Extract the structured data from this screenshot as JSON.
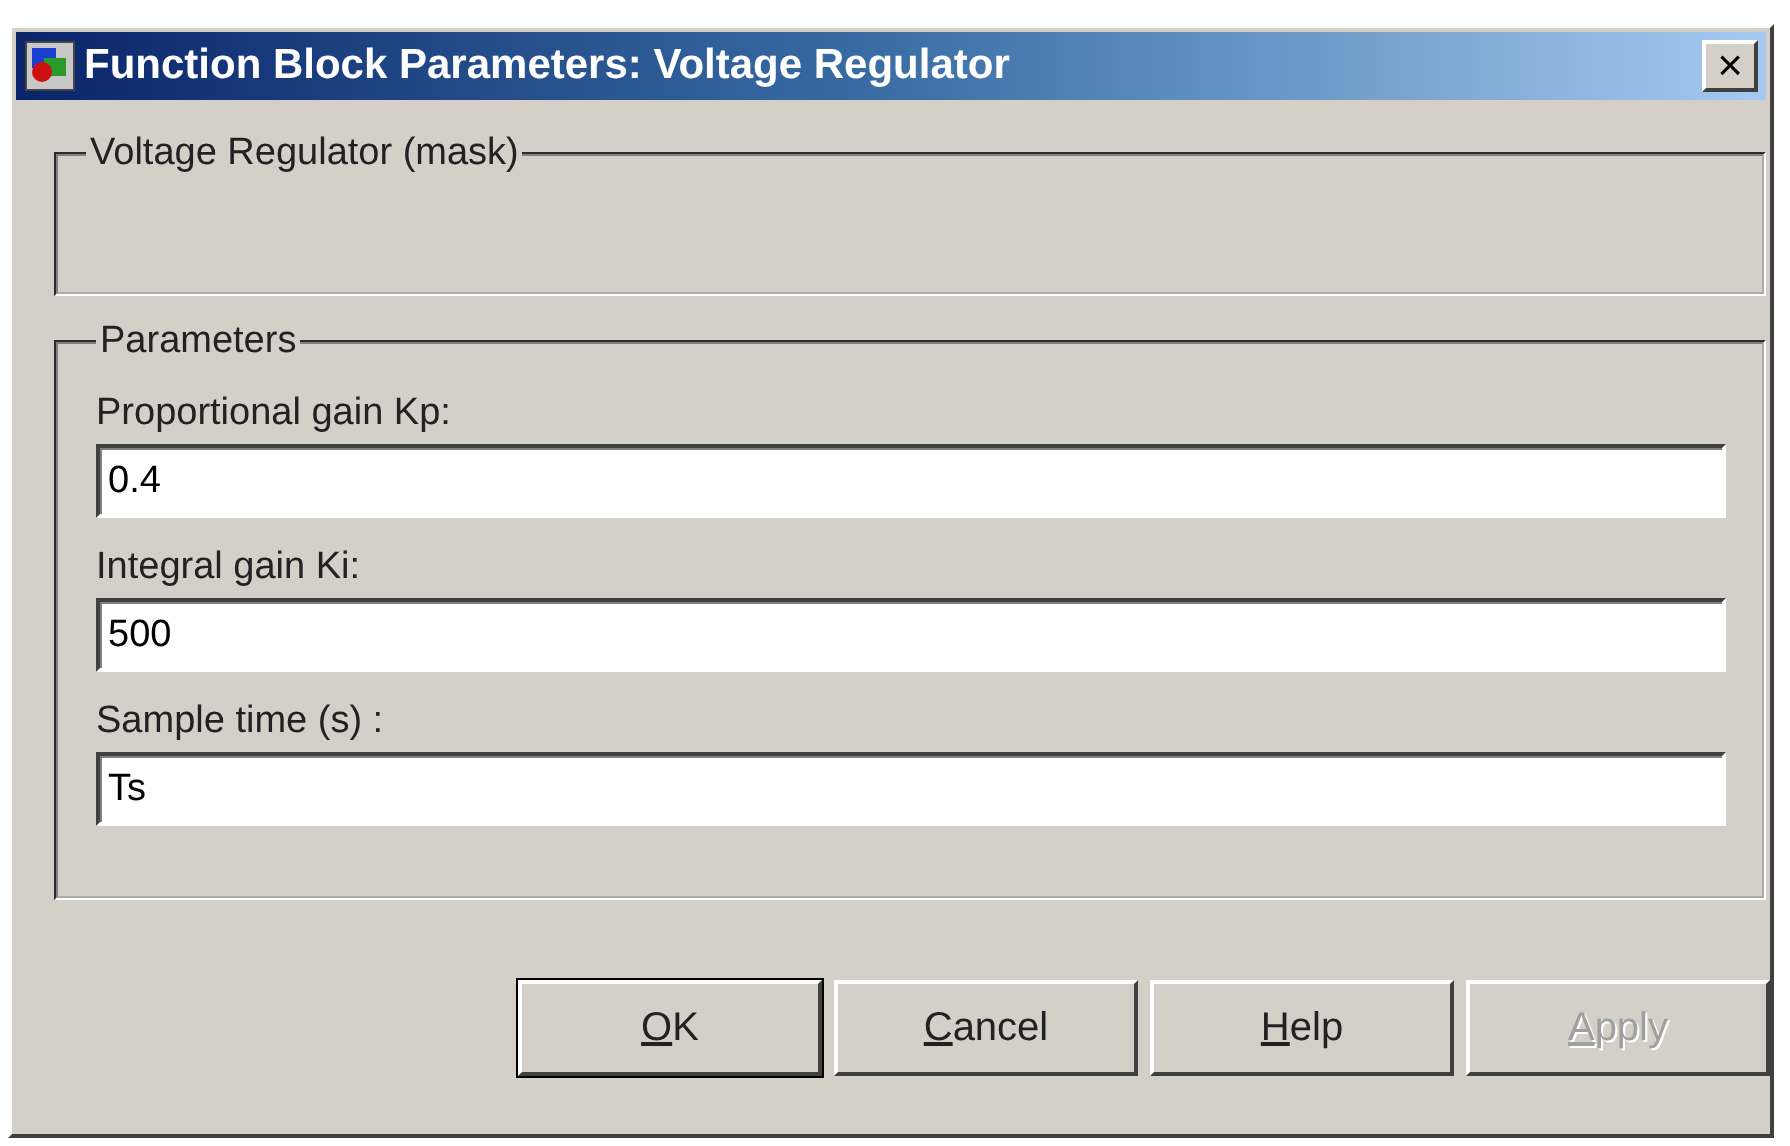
{
  "window": {
    "title": "Function Block Parameters: Voltage Regulator",
    "close": "×"
  },
  "description_group": {
    "title": "Voltage Regulator (mask)"
  },
  "parameters_group": {
    "title": "Parameters",
    "fields": [
      {
        "label": "Proportional gain  Kp:",
        "value": "0.4"
      },
      {
        "label": "Integral gain Ki:",
        "value": "500"
      },
      {
        "label": "Sample time (s) :",
        "value": "Ts"
      }
    ]
  },
  "buttons": [
    {
      "mnemonic": "O",
      "label_rest": "K",
      "default": true,
      "disabled": false
    },
    {
      "mnemonic": "C",
      "label_rest": "ancel",
      "default": false,
      "disabled": false
    },
    {
      "mnemonic": "H",
      "label_rest": "elp",
      "default": false,
      "disabled": false
    },
    {
      "mnemonic": "A",
      "label_rest": "pply",
      "default": false,
      "disabled": true
    }
  ]
}
